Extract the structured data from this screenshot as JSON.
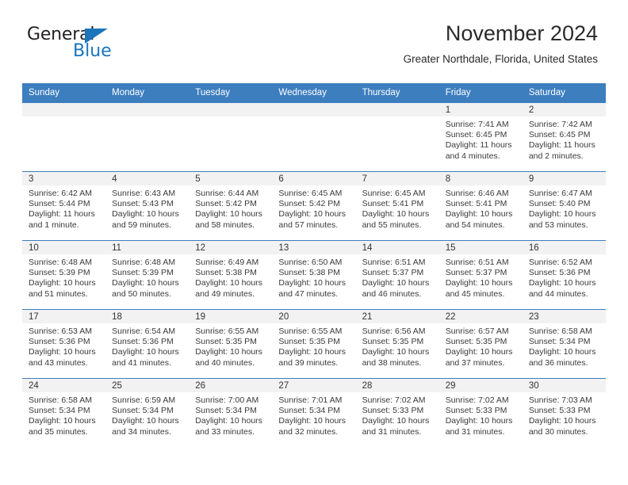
{
  "brand": {
    "name_part1": "General",
    "name_part2": "Blue",
    "triangle_color": "#1b75bb",
    "text_color": "#231f20"
  },
  "header": {
    "title": "November 2024",
    "subtitle": "Greater Northdale, Florida, United States",
    "header_bg_color": "#3d7ebf",
    "daynum_band_color": "#f2f2f2"
  },
  "weekday_headers": [
    "Sunday",
    "Monday",
    "Tuesday",
    "Wednesday",
    "Thursday",
    "Friday",
    "Saturday"
  ],
  "weeks": [
    [
      {
        "day": "",
        "sunrise": "",
        "sunset": "",
        "daylight": ""
      },
      {
        "day": "",
        "sunrise": "",
        "sunset": "",
        "daylight": ""
      },
      {
        "day": "",
        "sunrise": "",
        "sunset": "",
        "daylight": ""
      },
      {
        "day": "",
        "sunrise": "",
        "sunset": "",
        "daylight": ""
      },
      {
        "day": "",
        "sunrise": "",
        "sunset": "",
        "daylight": ""
      },
      {
        "day": "1",
        "sunrise": "Sunrise: 7:41 AM",
        "sunset": "Sunset: 6:45 PM",
        "daylight": "Daylight: 11 hours and 4 minutes."
      },
      {
        "day": "2",
        "sunrise": "Sunrise: 7:42 AM",
        "sunset": "Sunset: 6:45 PM",
        "daylight": "Daylight: 11 hours and 2 minutes."
      }
    ],
    [
      {
        "day": "3",
        "sunrise": "Sunrise: 6:42 AM",
        "sunset": "Sunset: 5:44 PM",
        "daylight": "Daylight: 11 hours and 1 minute."
      },
      {
        "day": "4",
        "sunrise": "Sunrise: 6:43 AM",
        "sunset": "Sunset: 5:43 PM",
        "daylight": "Daylight: 10 hours and 59 minutes."
      },
      {
        "day": "5",
        "sunrise": "Sunrise: 6:44 AM",
        "sunset": "Sunset: 5:42 PM",
        "daylight": "Daylight: 10 hours and 58 minutes."
      },
      {
        "day": "6",
        "sunrise": "Sunrise: 6:45 AM",
        "sunset": "Sunset: 5:42 PM",
        "daylight": "Daylight: 10 hours and 57 minutes."
      },
      {
        "day": "7",
        "sunrise": "Sunrise: 6:45 AM",
        "sunset": "Sunset: 5:41 PM",
        "daylight": "Daylight: 10 hours and 55 minutes."
      },
      {
        "day": "8",
        "sunrise": "Sunrise: 6:46 AM",
        "sunset": "Sunset: 5:41 PM",
        "daylight": "Daylight: 10 hours and 54 minutes."
      },
      {
        "day": "9",
        "sunrise": "Sunrise: 6:47 AM",
        "sunset": "Sunset: 5:40 PM",
        "daylight": "Daylight: 10 hours and 53 minutes."
      }
    ],
    [
      {
        "day": "10",
        "sunrise": "Sunrise: 6:48 AM",
        "sunset": "Sunset: 5:39 PM",
        "daylight": "Daylight: 10 hours and 51 minutes."
      },
      {
        "day": "11",
        "sunrise": "Sunrise: 6:48 AM",
        "sunset": "Sunset: 5:39 PM",
        "daylight": "Daylight: 10 hours and 50 minutes."
      },
      {
        "day": "12",
        "sunrise": "Sunrise: 6:49 AM",
        "sunset": "Sunset: 5:38 PM",
        "daylight": "Daylight: 10 hours and 49 minutes."
      },
      {
        "day": "13",
        "sunrise": "Sunrise: 6:50 AM",
        "sunset": "Sunset: 5:38 PM",
        "daylight": "Daylight: 10 hours and 47 minutes."
      },
      {
        "day": "14",
        "sunrise": "Sunrise: 6:51 AM",
        "sunset": "Sunset: 5:37 PM",
        "daylight": "Daylight: 10 hours and 46 minutes."
      },
      {
        "day": "15",
        "sunrise": "Sunrise: 6:51 AM",
        "sunset": "Sunset: 5:37 PM",
        "daylight": "Daylight: 10 hours and 45 minutes."
      },
      {
        "day": "16",
        "sunrise": "Sunrise: 6:52 AM",
        "sunset": "Sunset: 5:36 PM",
        "daylight": "Daylight: 10 hours and 44 minutes."
      }
    ],
    [
      {
        "day": "17",
        "sunrise": "Sunrise: 6:53 AM",
        "sunset": "Sunset: 5:36 PM",
        "daylight": "Daylight: 10 hours and 43 minutes."
      },
      {
        "day": "18",
        "sunrise": "Sunrise: 6:54 AM",
        "sunset": "Sunset: 5:36 PM",
        "daylight": "Daylight: 10 hours and 41 minutes."
      },
      {
        "day": "19",
        "sunrise": "Sunrise: 6:55 AM",
        "sunset": "Sunset: 5:35 PM",
        "daylight": "Daylight: 10 hours and 40 minutes."
      },
      {
        "day": "20",
        "sunrise": "Sunrise: 6:55 AM",
        "sunset": "Sunset: 5:35 PM",
        "daylight": "Daylight: 10 hours and 39 minutes."
      },
      {
        "day": "21",
        "sunrise": "Sunrise: 6:56 AM",
        "sunset": "Sunset: 5:35 PM",
        "daylight": "Daylight: 10 hours and 38 minutes."
      },
      {
        "day": "22",
        "sunrise": "Sunrise: 6:57 AM",
        "sunset": "Sunset: 5:35 PM",
        "daylight": "Daylight: 10 hours and 37 minutes."
      },
      {
        "day": "23",
        "sunrise": "Sunrise: 6:58 AM",
        "sunset": "Sunset: 5:34 PM",
        "daylight": "Daylight: 10 hours and 36 minutes."
      }
    ],
    [
      {
        "day": "24",
        "sunrise": "Sunrise: 6:58 AM",
        "sunset": "Sunset: 5:34 PM",
        "daylight": "Daylight: 10 hours and 35 minutes."
      },
      {
        "day": "25",
        "sunrise": "Sunrise: 6:59 AM",
        "sunset": "Sunset: 5:34 PM",
        "daylight": "Daylight: 10 hours and 34 minutes."
      },
      {
        "day": "26",
        "sunrise": "Sunrise: 7:00 AM",
        "sunset": "Sunset: 5:34 PM",
        "daylight": "Daylight: 10 hours and 33 minutes."
      },
      {
        "day": "27",
        "sunrise": "Sunrise: 7:01 AM",
        "sunset": "Sunset: 5:34 PM",
        "daylight": "Daylight: 10 hours and 32 minutes."
      },
      {
        "day": "28",
        "sunrise": "Sunrise: 7:02 AM",
        "sunset": "Sunset: 5:33 PM",
        "daylight": "Daylight: 10 hours and 31 minutes."
      },
      {
        "day": "29",
        "sunrise": "Sunrise: 7:02 AM",
        "sunset": "Sunset: 5:33 PM",
        "daylight": "Daylight: 10 hours and 31 minutes."
      },
      {
        "day": "30",
        "sunrise": "Sunrise: 7:03 AM",
        "sunset": "Sunset: 5:33 PM",
        "daylight": "Daylight: 10 hours and 30 minutes."
      }
    ]
  ]
}
